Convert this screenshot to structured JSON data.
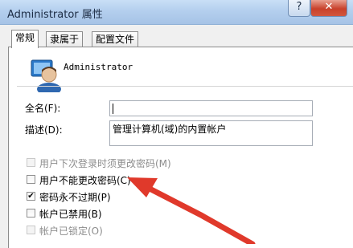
{
  "window": {
    "title": "Administrator 属性",
    "help_label": "?",
    "close_label": "✕"
  },
  "tabs": [
    {
      "label": "常规",
      "active": true
    },
    {
      "label": "隶属于",
      "active": false
    },
    {
      "label": "配置文件",
      "active": false
    }
  ],
  "user": {
    "name": "Administrator",
    "icon": "user-icon"
  },
  "form": {
    "fullname_label": "全名(F):",
    "fullname_value": "",
    "description_label": "描述(D):",
    "description_value": "管理计算机(域)的内置帐户"
  },
  "checkboxes": [
    {
      "label": "用户下次登录时须更改密码(M)",
      "checked": false,
      "enabled": false
    },
    {
      "label": "用户不能更改密码(C)",
      "checked": false,
      "enabled": true
    },
    {
      "label": "密码永不过期(P)",
      "checked": true,
      "enabled": true
    },
    {
      "label": "帐户已禁用(B)",
      "checked": false,
      "enabled": true
    },
    {
      "label": "帐户已锁定(O)",
      "checked": false,
      "enabled": false
    }
  ],
  "annotation": {
    "arrow_color": "#e0392b"
  }
}
